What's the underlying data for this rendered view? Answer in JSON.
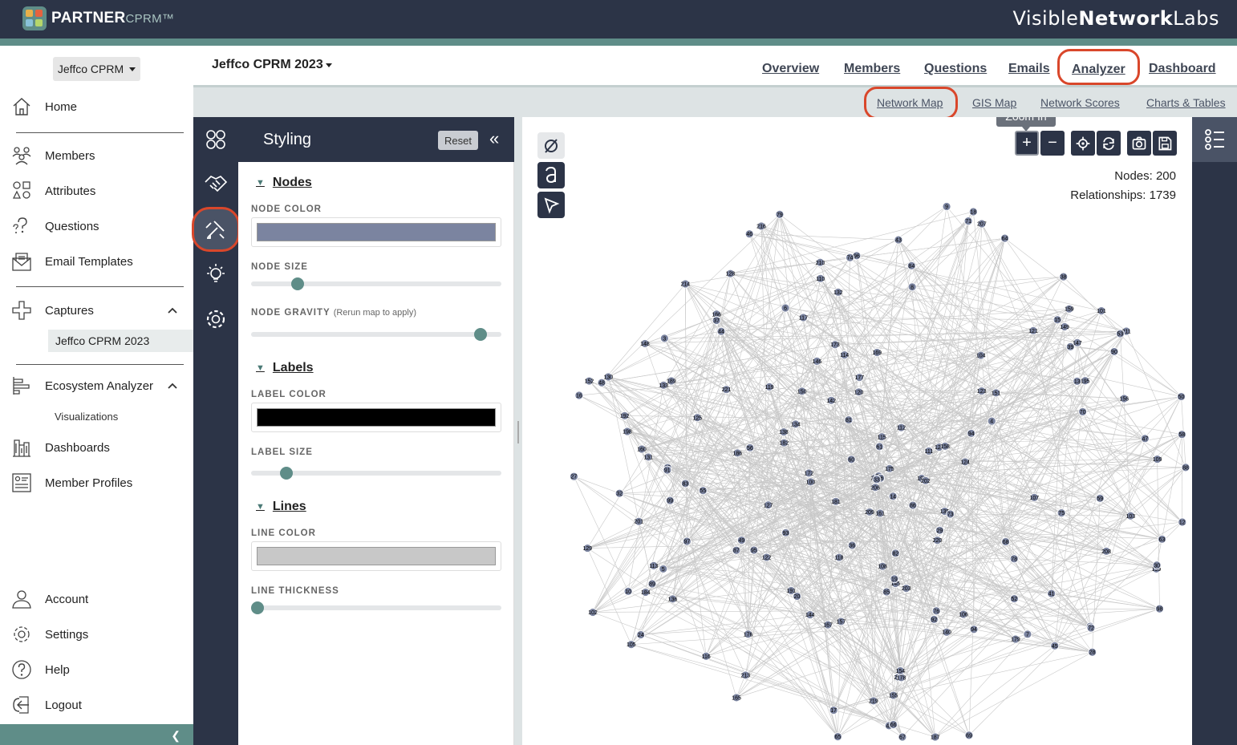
{
  "app": {
    "logo_text": "PARTNER",
    "logo_sub": "CPRM™",
    "brand_a": "Visible",
    "brand_b": "Network",
    "brand_c": "Labs"
  },
  "sidebar": {
    "org": "Jeffco CPRM",
    "items": [
      {
        "label": "Home",
        "icon": "home-icon"
      },
      {
        "label": "Members",
        "icon": "members-icon"
      },
      {
        "label": "Attributes",
        "icon": "attributes-icon"
      },
      {
        "label": "Questions",
        "icon": "questions-icon"
      },
      {
        "label": "Email Templates",
        "icon": "email-icon"
      },
      {
        "label": "Captures",
        "icon": "captures-icon"
      },
      {
        "label": "Ecosystem Analyzer",
        "icon": "analyzer-icon"
      },
      {
        "label": "Dashboards",
        "icon": "dashboards-icon"
      },
      {
        "label": "Member Profiles",
        "icon": "profiles-icon"
      },
      {
        "label": "Account",
        "icon": "account-icon"
      },
      {
        "label": "Settings",
        "icon": "settings-icon"
      },
      {
        "label": "Help",
        "icon": "help-icon"
      },
      {
        "label": "Logout",
        "icon": "logout-icon"
      }
    ],
    "captures_sub": "Jeffco CPRM 2023",
    "analyzer_sub": "Visualizations"
  },
  "header": {
    "project": "Jeffco CPRM 2023",
    "tabs": [
      "Overview",
      "Members",
      "Questions",
      "Emails",
      "Analyzer",
      "Dashboard"
    ],
    "active_tab": "Analyzer",
    "subtabs": [
      "Network Map",
      "GIS Map",
      "Network Scores",
      "Charts & Tables"
    ],
    "active_subtab": "Network Map"
  },
  "styling": {
    "title": "Styling",
    "reset": "Reset",
    "collapse": "«",
    "nodes": {
      "title": "Nodes",
      "color_label": "NODE COLOR",
      "color": "#7b84a0",
      "size_label": "NODE SIZE",
      "size": 0.17,
      "gravity_label": "NODE GRAVITY",
      "gravity_hint": "(Rerun map to apply)",
      "gravity": 0.94
    },
    "labels": {
      "title": "Labels",
      "color_label": "LABEL COLOR",
      "color": "#000000",
      "size_label": "LABEL SIZE",
      "size": 0.12
    },
    "lines": {
      "title": "Lines",
      "color_label": "LINE COLOR",
      "color": "#c8c8c8",
      "thickness_label": "LINE THICKNESS",
      "thickness": 0.0
    }
  },
  "map": {
    "tooltip": "Zoom In",
    "nodes_text": "Nodes: 200",
    "rel_text": "Relationships: 1739",
    "node_ids": [
      "215",
      "203",
      "198",
      "169",
      "192",
      "166",
      "42",
      "173",
      "208",
      "201",
      "207",
      "172",
      "216",
      "189",
      "211",
      "20",
      "165",
      "36",
      "167",
      "152",
      "15",
      "209",
      "25",
      "92",
      "199",
      "191",
      "195",
      "94",
      "157",
      "49",
      "186",
      "218",
      "129",
      "214",
      "131",
      "117",
      "105",
      "219",
      "176",
      "122",
      "159",
      "112",
      "181",
      "135",
      "187",
      "179",
      "221",
      "126",
      "101",
      "53",
      "17",
      "206",
      "197",
      "178",
      "32",
      "155",
      "67",
      "151",
      "100",
      "77",
      "13",
      "175",
      "124",
      "6",
      "145",
      "182",
      "61",
      "210",
      "75",
      "111",
      "81",
      "63",
      "38",
      "50",
      "184",
      "177",
      "24",
      "93",
      "48",
      "119",
      "213",
      "89",
      "118",
      "88",
      "121",
      "69",
      "7",
      "125",
      "156",
      "140",
      "106",
      "160",
      "91",
      "116",
      "103",
      "56",
      "120",
      "85",
      "5",
      "115",
      "90",
      "46",
      "12",
      "3",
      "147",
      "14",
      "86",
      "202",
      "70",
      "220",
      "142",
      "127",
      "102",
      "84",
      "87",
      "161",
      "47",
      "158",
      "52",
      "134",
      "73",
      "150",
      "99",
      "98",
      "144",
      "26",
      "78",
      "94",
      "43",
      "104",
      "18",
      "133",
      "95",
      "83",
      "132",
      "37",
      "149",
      "109",
      "55",
      "58",
      "68",
      "123",
      "96",
      "9",
      "108",
      "80",
      "71",
      "110",
      "97",
      "130",
      "65",
      "113",
      "76",
      "154",
      "64",
      "146",
      "28",
      "4",
      "33",
      "107",
      "39",
      "82",
      "79",
      "29",
      "59",
      "148",
      "45",
      "114",
      "16",
      "8",
      "74",
      "41",
      "60",
      "138",
      "19",
      "44",
      "66",
      "30",
      "136",
      "128",
      "72",
      "27",
      "10"
    ]
  }
}
